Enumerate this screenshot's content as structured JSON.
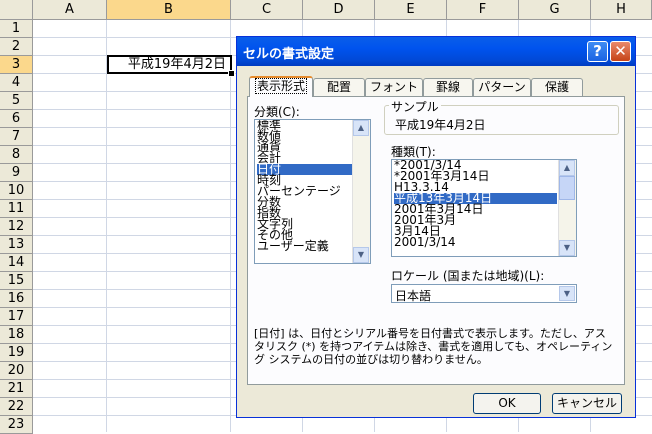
{
  "sheet": {
    "columns": [
      "A",
      "B",
      "C",
      "D",
      "E",
      "F",
      "G",
      "H"
    ],
    "rows": [
      "1",
      "2",
      "3",
      "4",
      "5",
      "6",
      "7",
      "8",
      "9",
      "10",
      "11",
      "12",
      "13",
      "14",
      "15",
      "16",
      "17",
      "18",
      "19",
      "20",
      "21",
      "22",
      "23"
    ],
    "active_cell_value": "平成19年4月2日"
  },
  "dialog": {
    "title": "セルの書式設定",
    "help_glyph": "?",
    "close_glyph": "✕",
    "tabs": [
      "表示形式",
      "配置",
      "フォント",
      "罫線",
      "パターン",
      "保護"
    ],
    "category_label": "分類(C):",
    "categories": [
      "標準",
      "数値",
      "通貨",
      "会計",
      "日付",
      "時刻",
      "パーセンテージ",
      "分数",
      "指数",
      "文字列",
      "その他",
      "ユーザー定義"
    ],
    "selected_category": "日付",
    "sample_label": "サンプル",
    "sample_value": "平成19年4月2日",
    "type_label": "種類(T):",
    "types": [
      "*2001/3/14",
      "*2001年3月14日",
      "H13.3.14",
      "平成13年3月14日",
      "2001年3月14日",
      "2001年3月",
      "3月14日",
      "2001/3/14"
    ],
    "selected_type": "平成13年3月14日",
    "locale_label": "ロケール (国または地域)(L):",
    "locale_value": "日本語",
    "description": "[日付] は、日付とシリアル番号を日付書式で表示します。ただし、アスタリスク (*) を持つアイテムは除き、書式を適用しても、オペレーティング システムの日付の並びは切り替わりません。",
    "ok_label": "OK",
    "cancel_label": "キャンセル"
  },
  "colors": {
    "titlebar": "#0053ee",
    "selection": "#316ac5",
    "header_selected": "#fbd88c",
    "dialog_face": "#ece9d8"
  }
}
